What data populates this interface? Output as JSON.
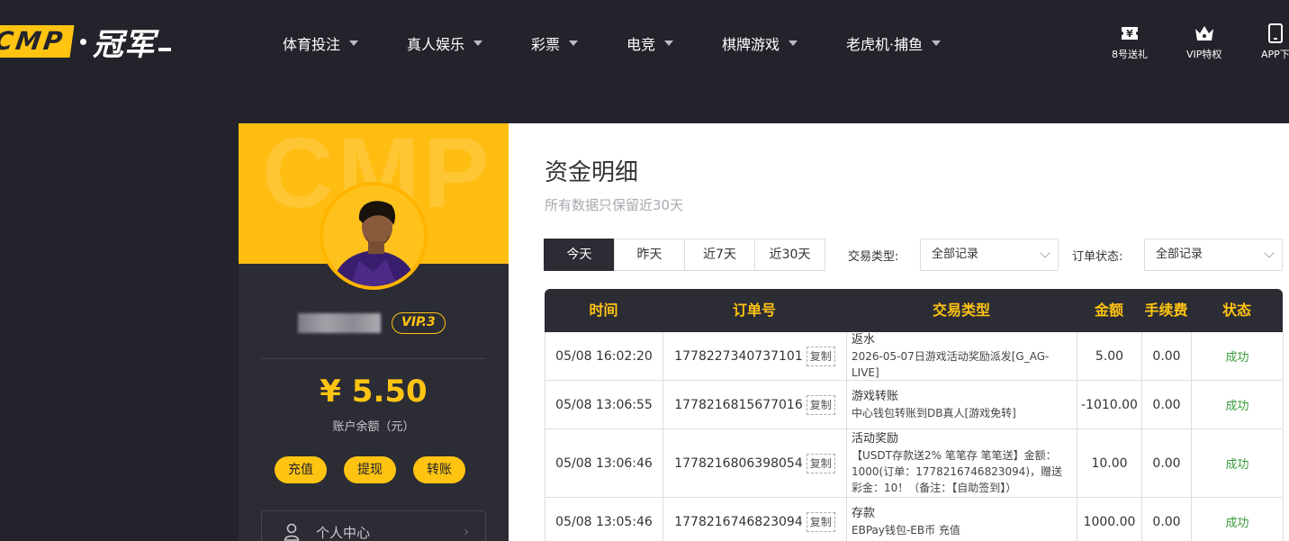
{
  "brand": {
    "logo_mark": "CMP",
    "logo_text": "冠军"
  },
  "nav": [
    {
      "label": "体育投注"
    },
    {
      "label": "真人娱乐"
    },
    {
      "label": "彩票"
    },
    {
      "label": "电竞"
    },
    {
      "label": "棋牌游戏"
    },
    {
      "label": "老虎机·捕鱼"
    }
  ],
  "quick_links": [
    {
      "label": "8号送礼",
      "icon": "ticket-icon"
    },
    {
      "label": "VIP特权",
      "icon": "crown-icon"
    },
    {
      "label": "APP下",
      "icon": "phone-icon"
    }
  ],
  "profile": {
    "watermark": "CMP",
    "vip": "VIP.3",
    "balance": "¥ 5.50",
    "balance_label": "账户余额（元）",
    "actions": [
      "充值",
      "提现",
      "转账"
    ],
    "menu": [
      {
        "label": "个人中心",
        "icon": "user-icon"
      }
    ]
  },
  "page": {
    "title": "资金明细",
    "subtitle": "所有数据只保留近30天",
    "date_tabs": [
      "今天",
      "昨天",
      "近7天",
      "近30天"
    ],
    "active_tab": "今天",
    "filters": [
      {
        "label": "交易类型:",
        "value": "全部记录"
      },
      {
        "label": "订单状态:",
        "value": "全部记录"
      }
    ]
  },
  "table": {
    "columns": [
      "时间",
      "订单号",
      "交易类型",
      "金额",
      "手续费",
      "状态"
    ],
    "copy_label": "复制",
    "rows": [
      {
        "time": "05/08 16:02:20",
        "order": "1778227340737101",
        "type": "返水",
        "detail": "2026-05-07日游戏活动奖励派发[G_AG-LIVE]",
        "amount": "5.00",
        "fee": "0.00",
        "status": "成功"
      },
      {
        "time": "05/08 13:06:55",
        "order": "1778216815677016",
        "type": "游戏转账",
        "detail": "中心钱包转账到DB真人[游戏免转]",
        "amount": "-1010.00",
        "fee": "0.00",
        "status": "成功"
      },
      {
        "time": "05/08 13:06:46",
        "order": "1778216806398054",
        "type": "活动奖励",
        "detail": "【USDT存款送2% 笔笔存 笔笔送】金额：1000(订单：1778216746823094)，赠送彩金：10！（备注：【自助签到】）",
        "amount": "10.00",
        "fee": "0.00",
        "status": "成功"
      },
      {
        "time": "05/08 13:05:46",
        "order": "1778216746823094",
        "type": "存款",
        "detail": "EBPay钱包-EB币 充值",
        "amount": "1000.00",
        "fee": "0.00",
        "status": "成功"
      }
    ]
  },
  "colors": {
    "accent": "#ffc412",
    "dark": "#23232b",
    "panel": "#2c2c35",
    "success": "#3a9a3a"
  }
}
